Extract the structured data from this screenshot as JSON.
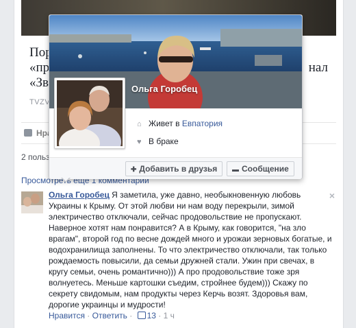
{
  "post": {
    "title_lines": [
      "Пор",
      "«пр",
      "«Зв"
    ],
    "title_right": "нал",
    "domain": "TVZV",
    "like_action": "Нра",
    "likes_count": "2 польз",
    "view_comments": "Просмотреть ещё 1 комментарий"
  },
  "hovercard": {
    "name": "Ольга Горобец",
    "lives_prefix": "Живет в",
    "lives_city": "Евпатория",
    "relationship": "В браке",
    "add_friend_label": "Добавить в друзья",
    "message_label": "Сообщение"
  },
  "comment": {
    "author": "Ольга Горобец",
    "lines": [
      " Я заметила, уже давно, необыкновенную любовь",
      "Украины к Крыму. От этой любви ни нам воду перекрыли, зимой",
      "электричество отключали, сейчас продовольствие не пропускают.",
      "Наверное хотят нам понравится? А в Крыму, как говорится, \"на зло",
      "врагам\", второй год по весне дождей много и урожаи зерновых богатые, и",
      "водохранилища заполнены. То что электричество отключали, так только",
      "рождаемость повысили, да семьи дружней стали. Ужин при свечах, в",
      "кругу семьи, очень романтично))) А про продовольствие тоже зря",
      "волнуетесь. Меньше картошки съедим, стройнее будем))) Скажу по",
      "секрету свидомым, нам продукты через Керчь возят. Здоровья вам,",
      "дорогие украинцы и мудрости!"
    ],
    "like_link": "Нравится",
    "sep1": " · ",
    "reply_link": "Ответить",
    "sep2": " · ",
    "likes": "13",
    "sep3": " · ",
    "time": "1 ч",
    "close": "×"
  },
  "colors": {
    "link": "#365899",
    "meta": "#90949c",
    "background": "#e9ebee"
  },
  "icons": [
    "home-icon",
    "heart-icon",
    "add-friend-icon",
    "message-icon",
    "like-thumb-icon",
    "close-icon"
  ]
}
